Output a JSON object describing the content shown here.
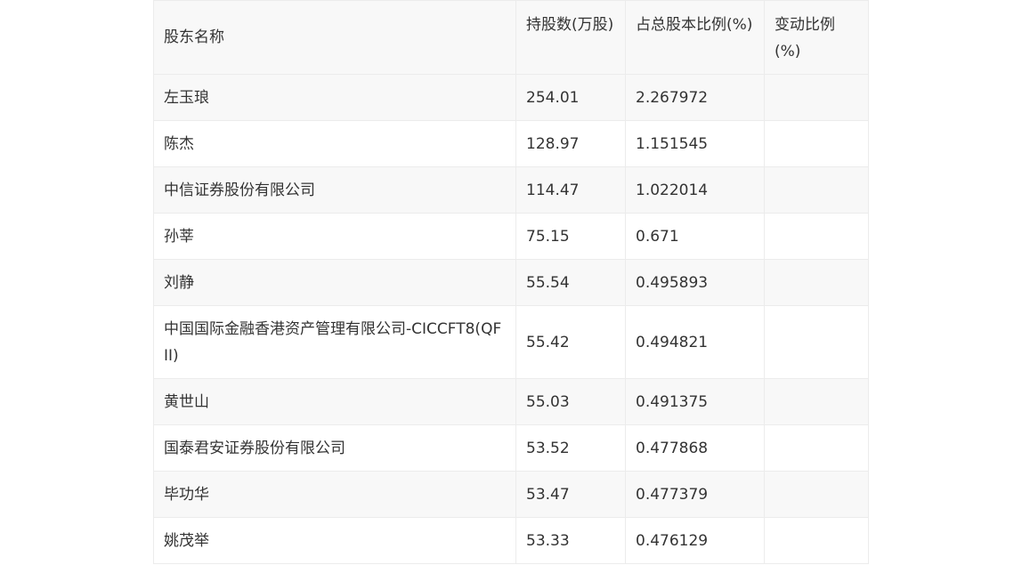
{
  "table": {
    "headers": [
      "股东名称",
      "持股数(万股)",
      "占总股本比例(%)",
      "变动比例(%)"
    ],
    "rows": [
      [
        "左玉琅",
        "254.01",
        "2.267972",
        ""
      ],
      [
        "陈杰",
        "128.97",
        "1.151545",
        ""
      ],
      [
        "中信证券股份有限公司",
        "114.47",
        "1.022014",
        ""
      ],
      [
        "孙莘",
        "75.15",
        "0.671",
        ""
      ],
      [
        "刘静",
        "55.54",
        "0.495893",
        ""
      ],
      [
        "中国国际金融香港资产管理有限公司-CICCFT8(QFII)",
        "55.42",
        "0.494821",
        ""
      ],
      [
        "黄世山",
        "55.03",
        "0.491375",
        ""
      ],
      [
        "国泰君安证券股份有限公司",
        "53.52",
        "0.477868",
        ""
      ],
      [
        "毕功华",
        "53.47",
        "0.477379",
        ""
      ],
      [
        "姚茂举",
        "53.33",
        "0.476129",
        ""
      ]
    ]
  }
}
